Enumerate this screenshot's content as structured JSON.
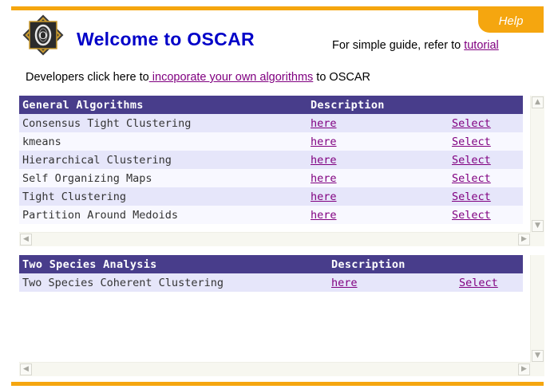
{
  "header": {
    "help_label": "Help",
    "logo_letter": "O",
    "title": "Welcome to OSCAR",
    "guide_text": "For simple guide, refer to ",
    "guide_link": "tutorial",
    "dev_prefix": "Developers click here to",
    "dev_link": " incoporate your own algorithms",
    "dev_suffix": " to OSCAR"
  },
  "general": {
    "header_name": "General Algorithms",
    "header_desc": "Description",
    "rows": [
      {
        "name": "Consensus Tight Clustering",
        "desc": "here",
        "select": "Select"
      },
      {
        "name": "kmeans",
        "desc": "here",
        "select": "Select"
      },
      {
        "name": "Hierarchical Clustering",
        "desc": "here",
        "select": "Select"
      },
      {
        "name": "Self Organizing Maps",
        "desc": "here",
        "select": "Select"
      },
      {
        "name": "Tight Clustering",
        "desc": "here",
        "select": "Select"
      },
      {
        "name": "Partition Around Medoids",
        "desc": "here",
        "select": "Select"
      }
    ]
  },
  "species": {
    "header_name": "Two Species Analysis",
    "header_desc": "Description",
    "rows": [
      {
        "name": "Two Species Coherent Clustering",
        "desc": "here",
        "select": "Select"
      }
    ]
  },
  "colors": {
    "accent_orange": "#f5a60f",
    "header_purple": "#483d8b",
    "title_blue": "#0000c8",
    "link_purple": "#800080",
    "row_odd": "#e6e6fa",
    "row_even": "#f8f8ff"
  },
  "icons": {
    "scroll_up": "scroll-up-arrow-icon",
    "scroll_down": "scroll-down-arrow-icon",
    "scroll_left": "scroll-left-arrow-icon",
    "scroll_right": "scroll-right-arrow-icon"
  }
}
